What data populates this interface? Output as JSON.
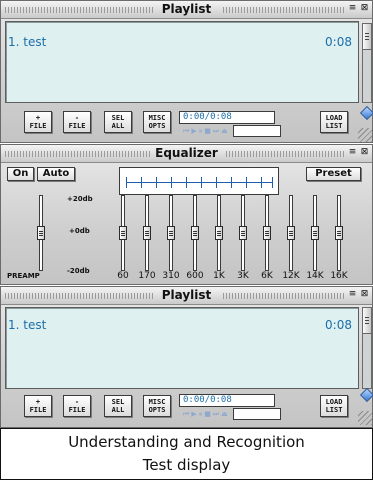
{
  "playlist_top": {
    "title": "Playlist",
    "window_controls": [
      "≡",
      "⊠"
    ],
    "tracks": [
      {
        "name": "1. test",
        "time": "0:08"
      }
    ],
    "buttons": {
      "add_file": "+\nFILE",
      "remove_file": "-\nFILE",
      "select_all": "SEL\nALL",
      "misc_opts": "MISC\nOPTS",
      "load_list": "LOAD\nLIST"
    },
    "time_display": "0:00/0:08",
    "transport_icons": [
      "previous-icon",
      "play-icon",
      "pause-icon",
      "stop-icon",
      "next-icon",
      "eject-icon"
    ]
  },
  "equalizer": {
    "title": "Equalizer",
    "window_controls": [
      "≡",
      "⊠"
    ],
    "on_label": "On",
    "auto_label": "Auto",
    "preset_label": "Preset",
    "db_labels": [
      "+20db",
      "+0db",
      "-20db"
    ],
    "preamp_label": "PREAMP",
    "bands": [
      {
        "label": "60",
        "level": 0
      },
      {
        "label": "170",
        "level": 0
      },
      {
        "label": "310",
        "level": 0
      },
      {
        "label": "600",
        "level": 0
      },
      {
        "label": "1K",
        "level": 0
      },
      {
        "label": "3K",
        "level": 0
      },
      {
        "label": "6K",
        "level": 0
      },
      {
        "label": "12K",
        "level": 0
      },
      {
        "label": "14K",
        "level": 0
      },
      {
        "label": "16K",
        "level": 0
      }
    ],
    "preamp_level": 0
  },
  "playlist_bottom": {
    "title": "Playlist",
    "window_controls": [
      "≡",
      "⊠"
    ],
    "tracks": [
      {
        "name": "1. test",
        "time": "0:08"
      }
    ],
    "buttons": {
      "add_file": "+\nFILE",
      "remove_file": "-\nFILE",
      "select_all": "SEL\nALL",
      "misc_opts": "MISC\nOPTS",
      "load_list": "LOAD\nLIST"
    },
    "time_display": "0:00/0:08",
    "transport_icons": [
      "previous-icon",
      "play-icon",
      "pause-icon",
      "stop-icon",
      "next-icon",
      "eject-icon"
    ]
  },
  "caption": {
    "line1": "Understanding and Recognition",
    "line2": "Test display"
  }
}
